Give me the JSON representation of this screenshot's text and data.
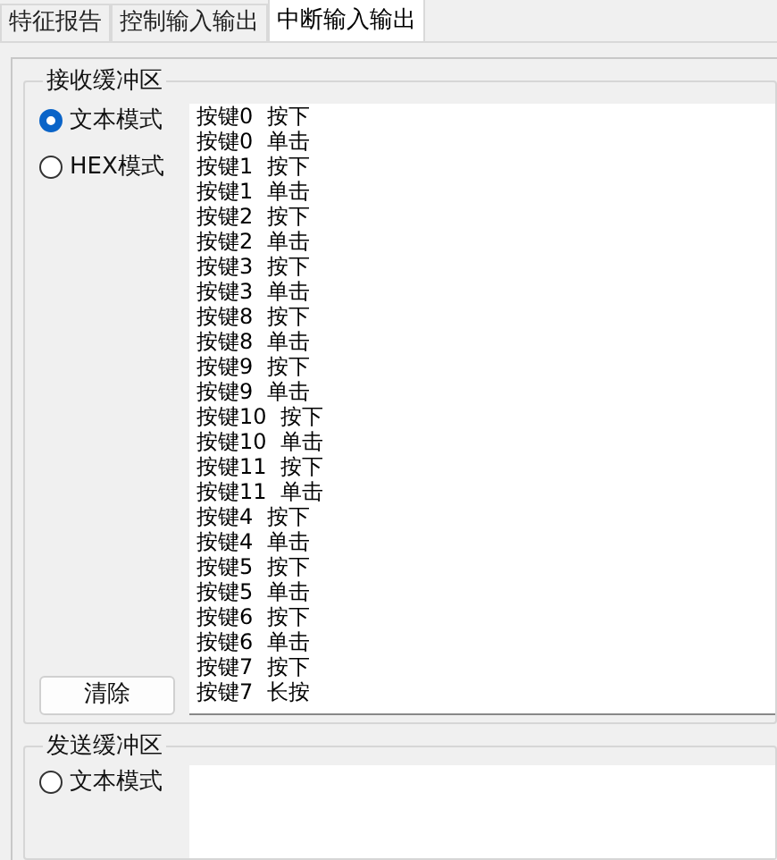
{
  "tabs": [
    {
      "label": "特征报告",
      "selected": false
    },
    {
      "label": "控制输入输出",
      "selected": false
    },
    {
      "label": "中断输入输出",
      "selected": true
    }
  ],
  "receive": {
    "title": "接收缓冲区",
    "modes": [
      {
        "label": "文本模式",
        "selected": true
      },
      {
        "label": "HEX模式",
        "selected": false
      }
    ],
    "lines": [
      "按键0  按下",
      "按键0  单击",
      "按键1  按下",
      "按键1  单击",
      "按键2  按下",
      "按键2  单击",
      "按键3  按下",
      "按键3  单击",
      "按键8  按下",
      "按键8  单击",
      "按键9  按下",
      "按键9  单击",
      "按键10  按下",
      "按键10  单击",
      "按键11  按下",
      "按键11  单击",
      "按键4  按下",
      "按键4  单击",
      "按键5  按下",
      "按键5  单击",
      "按键6  按下",
      "按键6  单击",
      "按键7  按下",
      "按键7  长按"
    ],
    "clear_button": "清除"
  },
  "send": {
    "title": "发送缓冲区",
    "modes": [
      {
        "label": "文本模式",
        "selected": false
      }
    ]
  }
}
